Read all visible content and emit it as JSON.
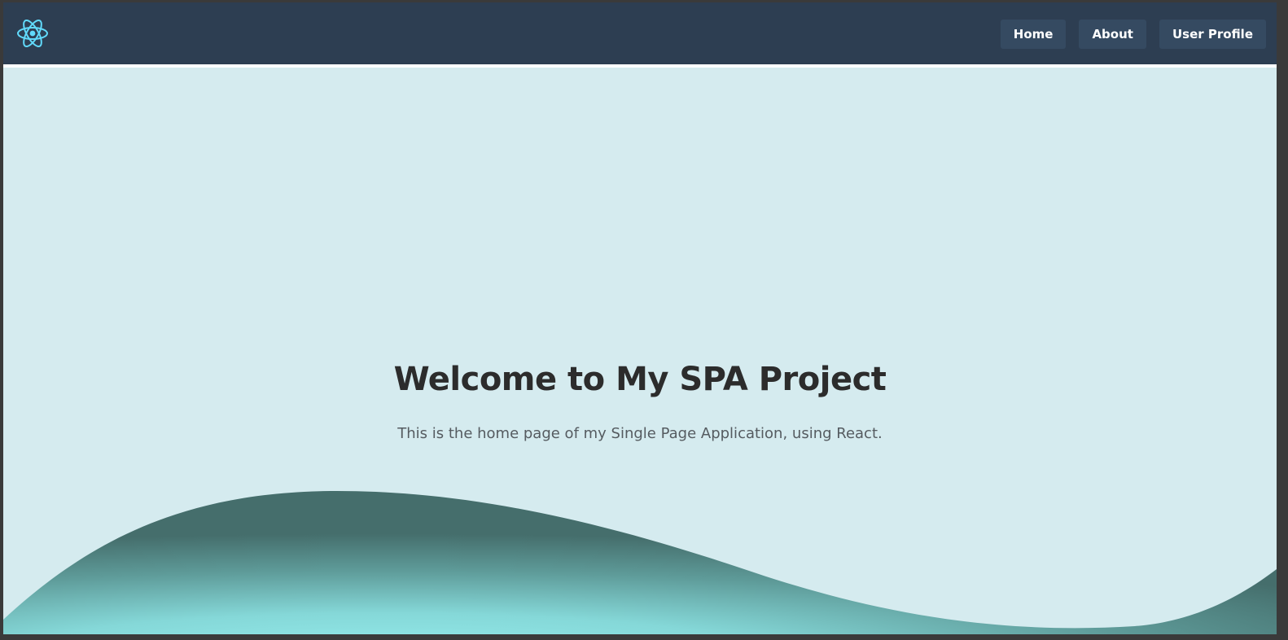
{
  "nav": {
    "logo_icon": "react-atom-icon",
    "links": [
      {
        "label": "Home"
      },
      {
        "label": "About"
      },
      {
        "label": "User Profile"
      }
    ]
  },
  "hero": {
    "title": "Welcome to My SPA Project",
    "subtitle": "This is the home page of my Single Page Application, using React."
  },
  "colors": {
    "navbar_bg": "#2d3e52",
    "nav_button_bg": "#354a61",
    "page_bg": "#d5ebef",
    "logo": "#61dafb",
    "wave_dark": "#4a7775",
    "wave_light": "#8fe6e6"
  }
}
